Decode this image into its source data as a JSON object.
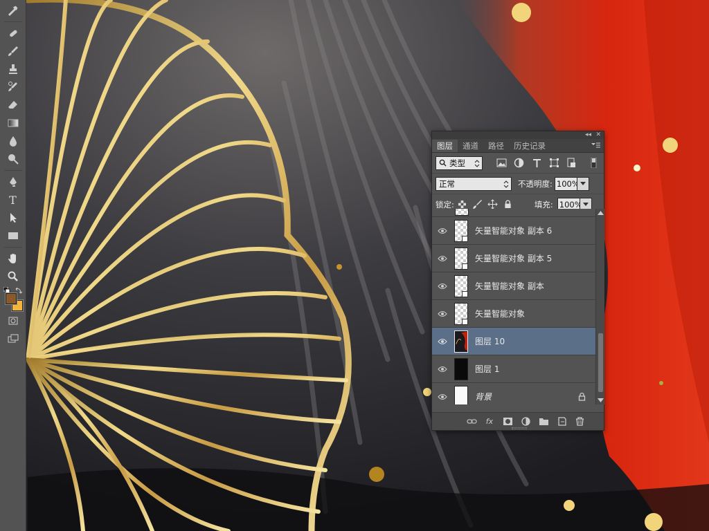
{
  "toolbox": {
    "tools": [
      "eyedropper-tool",
      "spot-healing-tool",
      "brush-tool",
      "clone-stamp-tool",
      "history-brush-tool",
      "eraser-tool",
      "gradient-tool",
      "blur-tool",
      "dodge-tool",
      "pen-tool",
      "type-tool",
      "path-selection-tool",
      "rectangle-tool",
      "hand-tool",
      "zoom-tool",
      "quick-mask-tool",
      "screen-mode-tool"
    ],
    "type_tool_glyph": "T",
    "foreground_color": "#8a5a2b",
    "background_color": "#f4b53a"
  },
  "layers_panel": {
    "tabs": [
      "图层",
      "通道",
      "路径",
      "历史记录"
    ],
    "active_tab": "图层",
    "filter": {
      "label": "类型"
    },
    "blend_mode": "正常",
    "opacity_label": "不透明度:",
    "opacity_value": "100%",
    "lock_label": "锁定:",
    "fill_label": "填充:",
    "fill_value": "100%",
    "layers": [
      {
        "name": "矢量智能对象 副本 6",
        "thumb": "checker",
        "smart": true,
        "visible": true,
        "selected": false
      },
      {
        "name": "矢量智能对象 副本 5",
        "thumb": "checker",
        "smart": true,
        "visible": true,
        "selected": false
      },
      {
        "name": "矢量智能对象 副本",
        "thumb": "checker",
        "smart": true,
        "visible": true,
        "selected": false
      },
      {
        "name": "矢量智能对象",
        "thumb": "checker",
        "smart": true,
        "visible": true,
        "selected": false
      },
      {
        "name": "图层 10",
        "thumb": "art",
        "smart": false,
        "visible": true,
        "selected": true
      },
      {
        "name": "图层 1",
        "thumb": "black",
        "smart": false,
        "visible": true,
        "selected": false
      },
      {
        "name": "背景",
        "thumb": "white",
        "smart": false,
        "visible": true,
        "selected": false,
        "locked": true
      }
    ],
    "footer_buttons": [
      "link-layers",
      "fx",
      "add-mask",
      "adjustment-layer",
      "new-group",
      "new-layer",
      "delete-layer"
    ],
    "fx_label": "fx"
  },
  "colors": {
    "panel_bg": "#535353",
    "selection": "#5c6f88",
    "gold": "#d9b45a",
    "red": "#d5250e"
  }
}
